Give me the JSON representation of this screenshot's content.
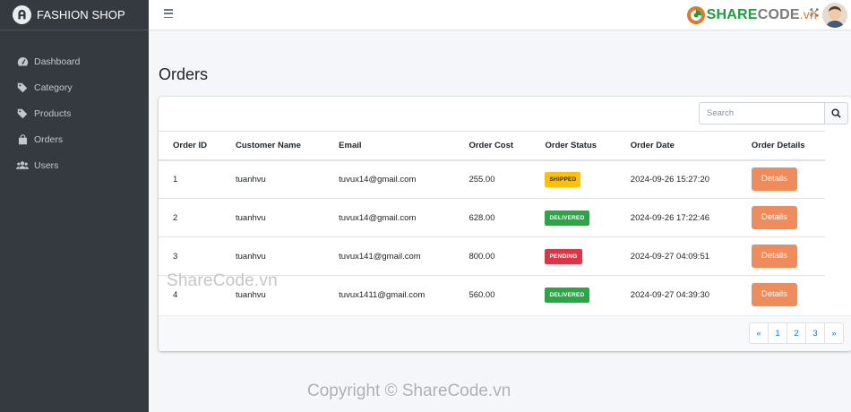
{
  "brand": {
    "name": "FASHION SHOP"
  },
  "sidebar": {
    "items": [
      {
        "label": "Dashboard",
        "icon": "tachometer-icon"
      },
      {
        "label": "Category",
        "icon": "tag-icon"
      },
      {
        "label": "Products",
        "icon": "tag-icon"
      },
      {
        "label": "Orders",
        "icon": "shopping-bag-icon"
      },
      {
        "label": "Users",
        "icon": "users-icon"
      }
    ]
  },
  "watermark": {
    "logo_green": "SHARE",
    "logo_grey": "CODE",
    "logo_suffix": ".vn",
    "overlay": "ShareCode.vn",
    "copyright": "Copyright © ShareCode.vn"
  },
  "page": {
    "title": "Orders"
  },
  "search": {
    "placeholder": "Search"
  },
  "table": {
    "headers": [
      "Order ID",
      "Customer Name",
      "Email",
      "Order Cost",
      "Order Status",
      "Order Date",
      "Order Details"
    ],
    "rows": [
      {
        "id": "1",
        "customer": "tuanhvu",
        "email": "tuvux14@gmail.com",
        "cost": "255.00",
        "status": "SHIPPED",
        "date": "2024-09-26 15:27:20",
        "action": "Details"
      },
      {
        "id": "2",
        "customer": "tuanhvu",
        "email": "tuvux14@gmail.com",
        "cost": "628.00",
        "status": "DELIVERED",
        "date": "2024-09-26 17:22:46",
        "action": "Details"
      },
      {
        "id": "3",
        "customer": "tuanhvu",
        "email": "tuvux141@gmail.com",
        "cost": "800.00",
        "status": "PENDING",
        "date": "2024-09-27 04:09:51",
        "action": "Details"
      },
      {
        "id": "4",
        "customer": "tuanhvu",
        "email": "tuvux1411@gmail.com",
        "cost": "560.00",
        "status": "DELIVERED",
        "date": "2024-09-27 04:39:30",
        "action": "Details"
      }
    ]
  },
  "pagination": {
    "prev": "«",
    "pages": [
      "1",
      "2",
      "3"
    ],
    "next": "»"
  },
  "colors": {
    "sidebar": "#343a40",
    "details_button": "#f08c5c",
    "shipped": "#ffc107",
    "delivered": "#28a745",
    "pending": "#dc3545",
    "link": "#007bff"
  }
}
